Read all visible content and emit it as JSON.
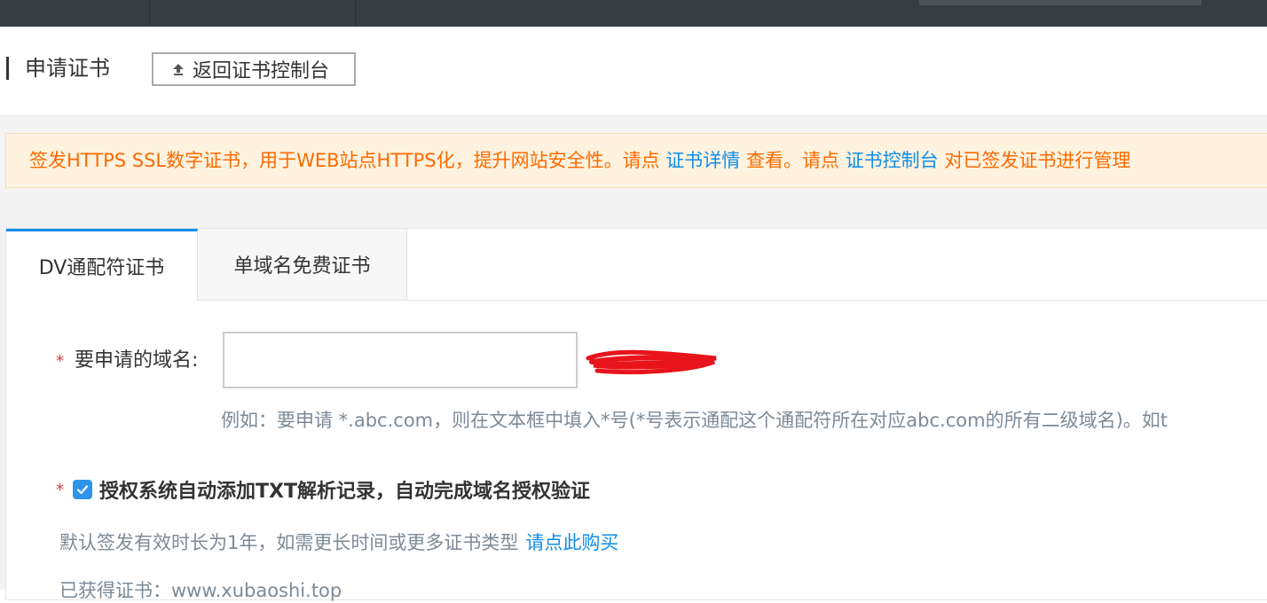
{
  "header": {
    "title": "申请证书",
    "back_button": "返回证书控制台"
  },
  "notice": {
    "text_1": "签发HTTPS SSL数字证书，用于WEB站点HTTPS化，提升网站安全性。请点",
    "link_1": "证书详情",
    "text_2": "查看。请点",
    "link_2": "证书控制台",
    "text_3": "对已签发证书进行管理"
  },
  "tabs": [
    {
      "label": "DV通配符证书",
      "active": true
    },
    {
      "label": "单域名免费证书",
      "active": false
    }
  ],
  "form": {
    "required_mark": "*",
    "domain_label": "要申请的域名:",
    "domain_value": "",
    "hint": "例如：要申请 *.abc.com，则在文本框中填入*号(*号表示通配这个通配符所在对应abc.com的所有二级域名)。如t",
    "auth_checked": true,
    "auth_label": "授权系统自动添加TXT解析记录，自动完成域名授权验证",
    "validity_text": "默认签发有效时长为1年，如需更长时间或更多证书类型",
    "buy_link": "请点此购买",
    "obtained_text": "已获得证书：www.xubaoshi.top"
  },
  "colors": {
    "accent": "#0f8de9",
    "warning": "#ff6a00",
    "required": "#e4393c",
    "topbar": "#373d41"
  },
  "icons": {
    "back": "upload-arrow-icon",
    "checkbox": "check-icon"
  }
}
